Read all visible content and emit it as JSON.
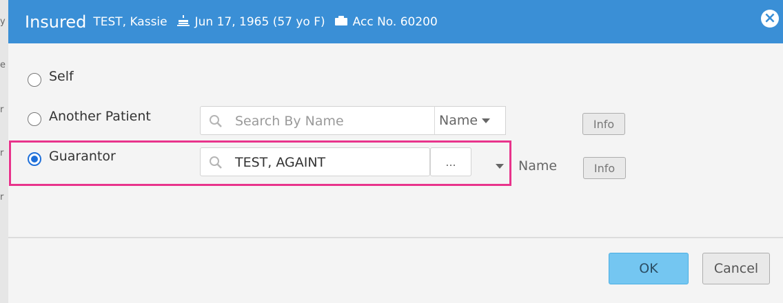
{
  "background": {
    "strip_chars": [
      "y",
      "e",
      "r",
      "r",
      "r"
    ]
  },
  "header": {
    "label": "Insured",
    "patient_name": "TEST, Kassie",
    "dob": "Jun 17, 1965 (57 yo F)",
    "account": "Acc No. 60200",
    "close_icon": "close-x-icon",
    "dob_icon": "birthday-cake-icon",
    "account_icon": "folder-icon",
    "color": "#3a8fd6"
  },
  "options": {
    "self": {
      "label": "Self",
      "selected": false
    },
    "another_patient": {
      "label": "Another Patient",
      "selected": false,
      "search_placeholder": "Search By Name",
      "search_value": "",
      "search_by": "Name",
      "info_label": "Info"
    },
    "guarantor": {
      "label": "Guarantor",
      "selected": true,
      "search_value": "TEST, AGAINT",
      "ellipsis_label": "...",
      "search_by": "Name",
      "info_label": "Info"
    }
  },
  "footer": {
    "ok_label": "OK",
    "cancel_label": "Cancel",
    "ok_color": "#74c6f1"
  },
  "highlight_color": "#e8338b"
}
